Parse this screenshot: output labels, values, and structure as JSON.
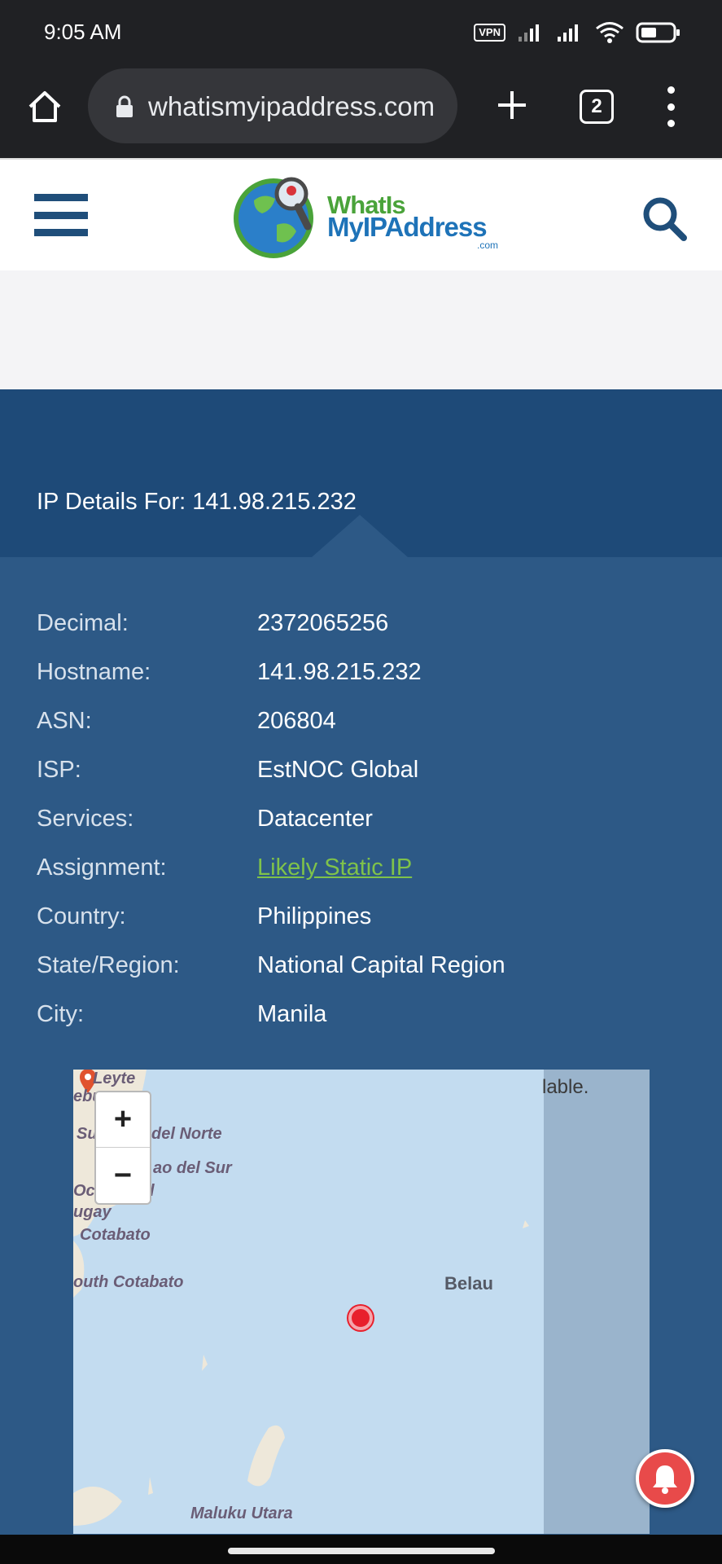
{
  "status_bar": {
    "time": "9:05 AM",
    "vpn_label": "VPN",
    "battery_icon": "battery-icon",
    "wifi_icon": "wifi-icon",
    "signal_icon": "signal-icon"
  },
  "browser": {
    "url": "whatismyipaddress.com",
    "tab_count": "2",
    "icons": [
      "home-icon",
      "lock-icon",
      "plus-icon",
      "tabs-icon",
      "more-vert-icon"
    ]
  },
  "site": {
    "logo_line1": "WhatIs",
    "logo_line2": "MyIPAddress",
    "logo_suffix": ".com",
    "brand_blue": "#1f4e7a",
    "brand_green": "#4aa33a"
  },
  "ip_details": {
    "title": "IP Details For: 141.98.215.232",
    "rows": [
      {
        "label": "Decimal:",
        "value": "2372065256"
      },
      {
        "label": "Hostname:",
        "value": "141.98.215.232"
      },
      {
        "label": "ASN:",
        "value": "206804"
      },
      {
        "label": "ISP:",
        "value": "EstNOC Global"
      },
      {
        "label": "Services:",
        "value": "Datacenter"
      },
      {
        "label": "Assignment:",
        "value": "Likely Static IP"
      },
      {
        "label": "Country:",
        "value": "Philippines"
      },
      {
        "label": "State/Region:",
        "value": "National Capital Region"
      },
      {
        "label": "City:",
        "value": "Manila"
      }
    ]
  },
  "map": {
    "note": "lable.",
    "zoom_in": "+",
    "zoom_out": "−",
    "places": [
      "Leyte",
      "ebu",
      "Su",
      "del Norte",
      "ao del Sur",
      "Occ",
      "l",
      "ugay",
      "Cotabato",
      "outh Cotabato",
      "Belau",
      "Maluku Utara"
    ]
  }
}
